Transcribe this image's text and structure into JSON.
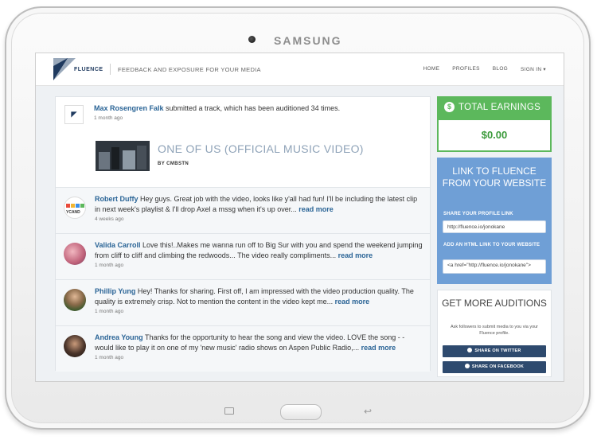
{
  "device": {
    "brand": "SAMSUNG"
  },
  "header": {
    "logo_text": "FLUENCE",
    "tagline": "FEEDBACK AND EXPOSURE FOR YOUR MEDIA",
    "nav": [
      "HOME",
      "PROFILES",
      "BLOG",
      "SIGN IN ▾"
    ]
  },
  "post": {
    "author": "Max Rosengren Falk",
    "text": " submitted a track, which has been auditioned 34 times.",
    "time": "1 month ago",
    "video_title": "ONE OF US (OFFICIAL MUSIC VIDEO)",
    "by": "BY CMBSTN"
  },
  "comments": [
    {
      "author": "Robert Duffy",
      "text": " Hey guys. Great job with the video, looks like y'all had fun! I'll be including the latest clip in next week's playlist & I'll drop Axel a mssg when it's up over... ",
      "more": "read more",
      "time": "4 weeks ago",
      "avatar_text": "YCAND"
    },
    {
      "author": "Valida Carroll",
      "text": " Love this!..Makes me wanna run off to Big Sur with you and spend the weekend jumping from cliff to cliff and climbing the redwoods... The video really compliments... ",
      "more": "read more",
      "time": "1 month ago"
    },
    {
      "author": "Phillip Yung",
      "text": " Hey! Thanks for sharing. First off, I am impressed with the video production quality. The quality is extremely crisp. Not to mention the content in the video kept me... ",
      "more": "read more",
      "time": "1 month ago"
    },
    {
      "author": "Andrea Young",
      "text": " Thanks for the opportunity to hear the song and view the video. LOVE the song - - would like to play it on one of my 'new music' radio shows on Aspen Public Radio,... ",
      "more": "read more",
      "time": "1 month ago"
    }
  ],
  "earnings": {
    "label": "TOTAL EARNINGS",
    "value": "$0.00",
    "icon": "dollar-icon"
  },
  "link": {
    "title": "LINK TO FLUENCE FROM YOUR WEBSITE",
    "profile_label": "SHARE YOUR PROFILE LINK",
    "profile_value": "http://fluence.io/jonokane",
    "html_label": "ADD AN HTML LINK TO YOUR WEBSITE",
    "html_value": "<a href=\"http://fluence.io/jonokane\">"
  },
  "auditions": {
    "title": "GET MORE AUDITIONS",
    "desc": "Ask followers to submit media to you via your Fluence profile.",
    "twitter": "SHARE ON TWITTER",
    "facebook": "SHARE ON FACEBOOK"
  },
  "colors": {
    "green": "#5cb85c",
    "blue_panel": "#6f9fd6",
    "link": "#2a6496",
    "navy": "#2e4a6e"
  }
}
